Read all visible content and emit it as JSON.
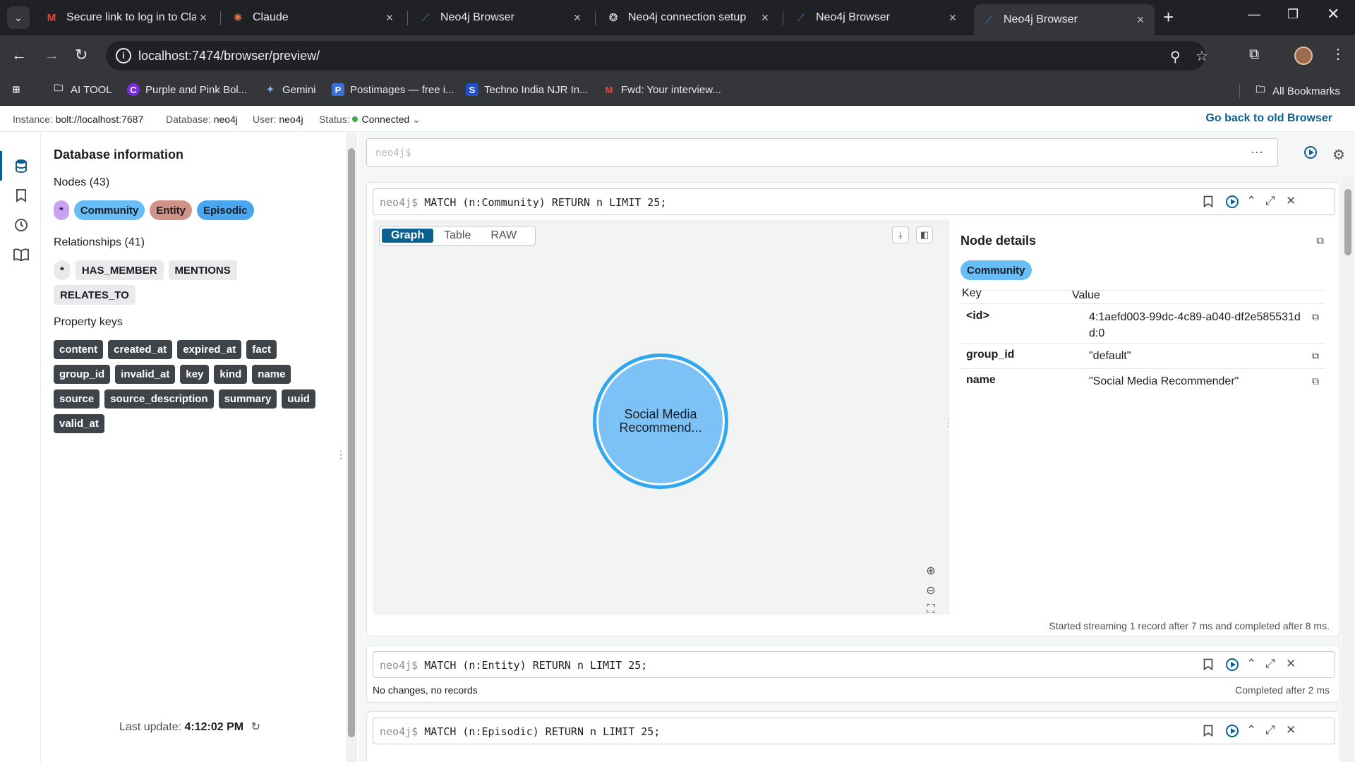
{
  "browser": {
    "tabs": [
      {
        "title": "Secure link to log in to Claude",
        "favicon": "gmail-icon",
        "color": "#ea4335"
      },
      {
        "title": "Claude",
        "favicon": "claude-icon",
        "color": "#d97757"
      },
      {
        "title": "Neo4j Browser",
        "favicon": "neo4j-icon",
        "color": "#4581c3"
      },
      {
        "title": "Neo4j connection setup",
        "favicon": "openai-icon",
        "color": "#e8eaed"
      },
      {
        "title": "Neo4j Browser",
        "favicon": "neo4j-icon",
        "color": "#4581c3"
      },
      {
        "title": "Neo4j Browser",
        "favicon": "neo4j-icon",
        "color": "#4581c3"
      }
    ],
    "url": "localhost:7474/browser/preview/",
    "bookmarks": [
      {
        "label": "AI TOOL",
        "icon": "folder-icon"
      },
      {
        "label": "Purple and Pink Bol...",
        "icon": "canva-icon"
      },
      {
        "label": "Gemini",
        "icon": "gemini-icon"
      },
      {
        "label": "Postimages — free i...",
        "icon": "postimages-icon"
      },
      {
        "label": "Techno India NJR In...",
        "icon": "s-icon"
      },
      {
        "label": "Fwd: Your interview...",
        "icon": "gmail-icon"
      }
    ],
    "all_bookmarks": "All Bookmarks"
  },
  "status": {
    "instance_label": "Instance:",
    "instance": "bolt://localhost:7687",
    "database_label": "Database:",
    "database": "neo4j",
    "user_label": "User:",
    "user": "neo4j",
    "status_label": "Status:",
    "status": "Connected",
    "go_back": "Go back to old Browser"
  },
  "sidebar": {
    "title": "Database information",
    "nodes_heading": "Nodes (43)",
    "node_labels": [
      "*",
      "Community",
      "Entity",
      "Episodic"
    ],
    "rels_heading": "Relationships (41)",
    "rel_types": [
      "*",
      "HAS_MEMBER",
      "MENTIONS",
      "RELATES_TO"
    ],
    "props_heading": "Property keys",
    "property_keys": [
      "content",
      "created_at",
      "expired_at",
      "fact",
      "group_id",
      "invalid_at",
      "key",
      "kind",
      "name",
      "source",
      "source_description",
      "summary",
      "uuid",
      "valid_at"
    ],
    "last_update_label": "Last update:",
    "last_update": "4:12:02 PM"
  },
  "editor": {
    "placeholder": "neo4j$"
  },
  "frames": [
    {
      "prompt": "neo4j$",
      "query": "MATCH (n:Community) RETURN n LIMIT 25;",
      "views": [
        "Graph",
        "Table",
        "RAW"
      ],
      "node_caption": "Social Media Recommend...",
      "node_color": "#7cc2f7",
      "details_title": "Node details",
      "details_label": "Community",
      "key_header": "Key",
      "value_header": "Value",
      "properties": [
        {
          "key": "<id>",
          "value": "4:1aefd003-99dc-4c89-a040-df2e585531dd:0"
        },
        {
          "key": "group_id",
          "value": "\"default\""
        },
        {
          "key": "name",
          "value": "\"Social Media Recommender\""
        }
      ],
      "status": "Started streaming 1 record after 7 ms and completed after 8 ms."
    },
    {
      "prompt": "neo4j$",
      "query": "MATCH (n:Entity) RETURN n LIMIT 25;",
      "result": "No changes, no records",
      "status": "Completed after 2 ms"
    },
    {
      "prompt": "neo4j$",
      "query": "MATCH (n:Episodic) RETURN n LIMIT 25;"
    }
  ]
}
